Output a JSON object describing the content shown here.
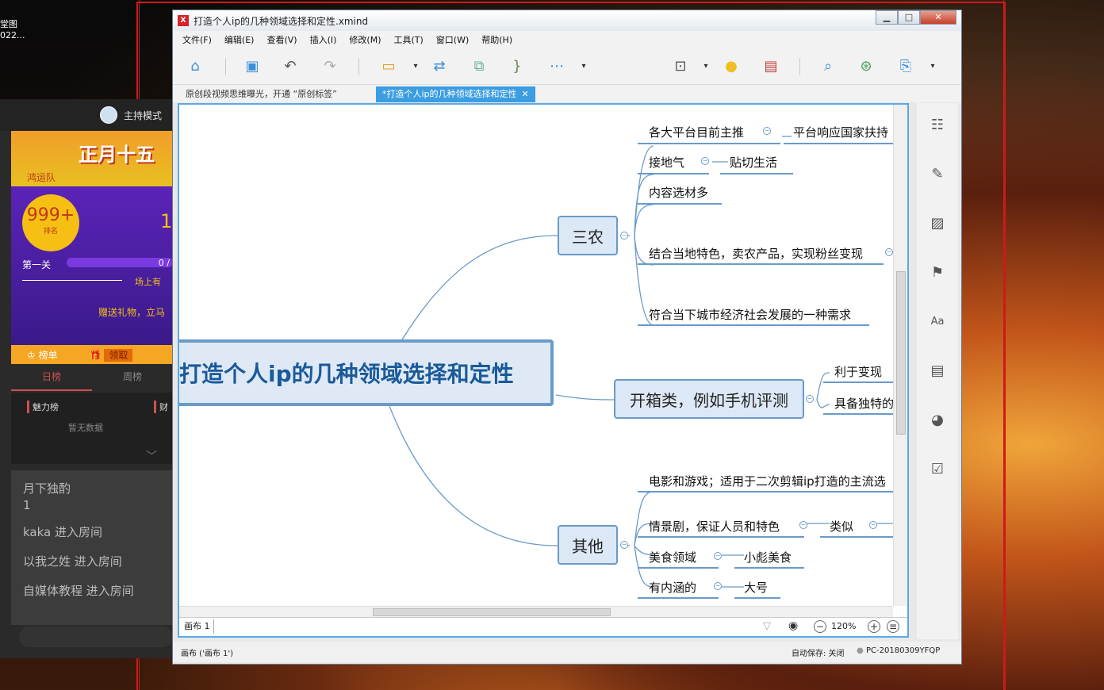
{
  "desktop": {
    "label1": "堂图",
    "label2": "022..."
  },
  "stream": {
    "host_mode": "主持模式",
    "banner_text": "正月十五",
    "team": "鸿运队",
    "rank": "999+",
    "rank_sub": "排名",
    "rank_right": "1",
    "stage": "第一关",
    "progress_text": "0 /",
    "progress_value": 0,
    "field_text": "场上有",
    "gift_prompt": "赠送礼物，立马",
    "rank_list": "榜单",
    "claim": "领取",
    "tab_day": "日榜",
    "tab_week": "周榜",
    "charm": "魅力榜",
    "wealth": "财",
    "empty": "暂无数据",
    "chat": [
      "月下独酌",
      "1",
      "kaka 进入房间",
      "以我之姓 进入房间",
      "自媒体教程 进入房间"
    ]
  },
  "window": {
    "title": "打造个人ip的几种领域选择和定性.xmind",
    "app_icon": "X",
    "menu": [
      "文件(F)",
      "编辑(E)",
      "查看(V)",
      "插入(I)",
      "修改(M)",
      "工具(T)",
      "窗口(W)",
      "帮助(H)"
    ],
    "tabs": {
      "inactive": "原创段视频思维曝光，开通 “原创标签”",
      "active": "*打造个人ip的几种领域选择和定性",
      "close": "✕"
    },
    "sheet_tab": "画布 1",
    "zoom": "120%",
    "status_left": "画布 ('画布 1')",
    "status_autosave": "自动保存: 关闭",
    "status_pc": "PC-20180309YFQP"
  },
  "mindmap": {
    "central": "打造个人ip的几种领域选择和定性",
    "sannong": {
      "label": "三农",
      "children": [
        {
          "text": "各大平台目前主推",
          "child": "平台响应国家扶持"
        },
        {
          "text": "接地气",
          "child": "贴切生活"
        },
        {
          "text": "内容选材多"
        },
        {
          "text": "结合当地特色，卖农产品，实现粉丝变现"
        },
        {
          "text": "符合当下城市经济社会发展的一种需求"
        }
      ]
    },
    "kaixiang": {
      "label": "开箱类，例如手机评测",
      "children": [
        {
          "text": "利于变现"
        },
        {
          "text": "具备独特的"
        }
      ]
    },
    "qita": {
      "label": "其他",
      "children": [
        {
          "text": "电影和游戏；适用于二次剪辑ip打造的主流选"
        },
        {
          "text": "情景剧，保证人员和特色",
          "child": "类似"
        },
        {
          "text": "美食领域",
          "child": "小彪美食"
        },
        {
          "text": "有内涵的",
          "child": "大号"
        }
      ]
    }
  },
  "colors": {
    "accent": "#3c9de0",
    "topic_border": "#6a9ac8",
    "central_text": "#1a5a9a"
  }
}
